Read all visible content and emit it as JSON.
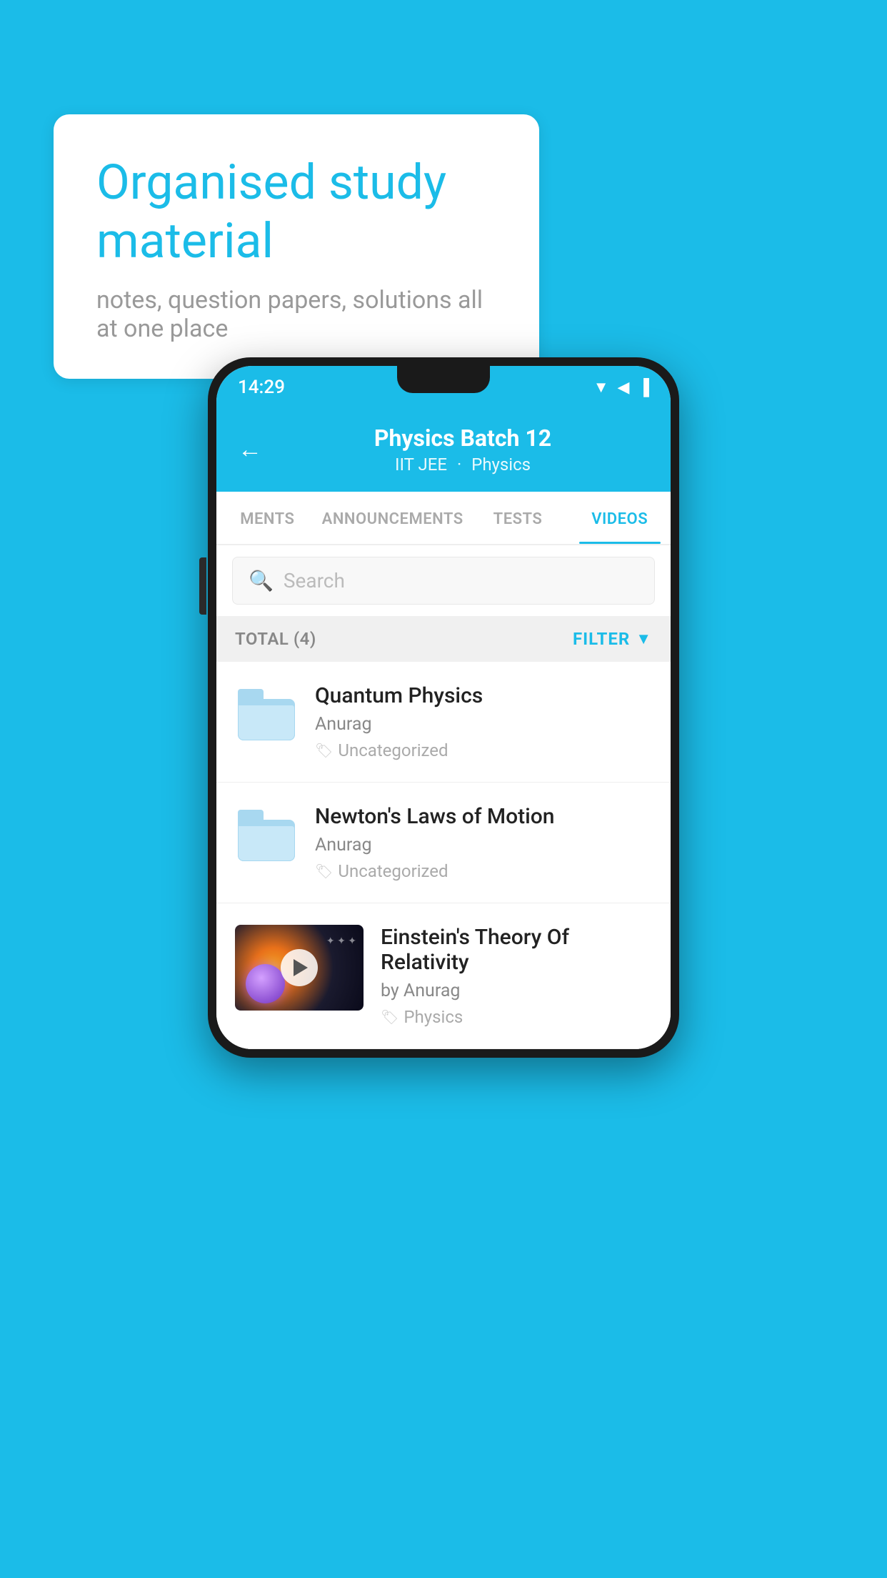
{
  "background_color": "#1BBCE8",
  "speech_bubble": {
    "heading": "Organised study material",
    "subtext": "notes, question papers, solutions all at one place"
  },
  "phone": {
    "status_bar": {
      "time": "14:29",
      "icons": [
        "wifi",
        "signal",
        "battery"
      ]
    },
    "app_bar": {
      "title": "Physics Batch 12",
      "subtitle_left": "IIT JEE",
      "subtitle_right": "Physics",
      "back_label": "←"
    },
    "tabs": [
      {
        "label": "MENTS",
        "active": false
      },
      {
        "label": "ANNOUNCEMENTS",
        "active": false
      },
      {
        "label": "TESTS",
        "active": false
      },
      {
        "label": "VIDEOS",
        "active": true
      }
    ],
    "search": {
      "placeholder": "Search"
    },
    "filter_bar": {
      "total_label": "TOTAL (4)",
      "filter_label": "FILTER"
    },
    "videos": [
      {
        "id": 1,
        "title": "Quantum Physics",
        "author": "Anurag",
        "tag": "Uncategorized",
        "has_thumbnail": false
      },
      {
        "id": 2,
        "title": "Newton's Laws of Motion",
        "author": "Anurag",
        "tag": "Uncategorized",
        "has_thumbnail": false
      },
      {
        "id": 3,
        "title": "Einstein's Theory Of Relativity",
        "author": "by Anurag",
        "tag": "Physics",
        "has_thumbnail": true
      }
    ]
  }
}
